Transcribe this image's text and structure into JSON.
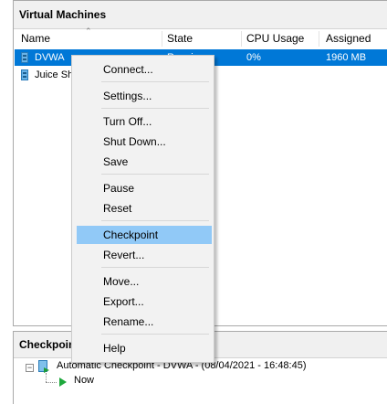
{
  "vm_panel": {
    "title": "Virtual Machines",
    "columns": [
      "Name",
      "State",
      "CPU Usage",
      "Assigned Me"
    ],
    "rows": [
      {
        "name": "DVWA",
        "state": "Runnin",
        "cpu": "0%",
        "memory": "1960 MB",
        "selected": true
      },
      {
        "name": "Juice Sh",
        "state": "",
        "cpu": "",
        "memory": "",
        "selected": false
      }
    ]
  },
  "checkpoint_panel": {
    "title": "Checkpoin",
    "items": [
      {
        "label": "Automatic Checkpoint - DVWA - (08/04/2021 - 16:48:45)"
      },
      {
        "label": "Now"
      }
    ]
  },
  "context_menu": {
    "items": [
      "Connect...",
      "Settings...",
      "Turn Off...",
      "Shut Down...",
      "Save",
      "Pause",
      "Reset",
      "Checkpoint",
      "Revert...",
      "Move...",
      "Export...",
      "Rename...",
      "Help"
    ],
    "highlighted": "Checkpoint"
  },
  "colors": {
    "selection": "#0078d7",
    "menu_highlight": "#91c9f7"
  }
}
